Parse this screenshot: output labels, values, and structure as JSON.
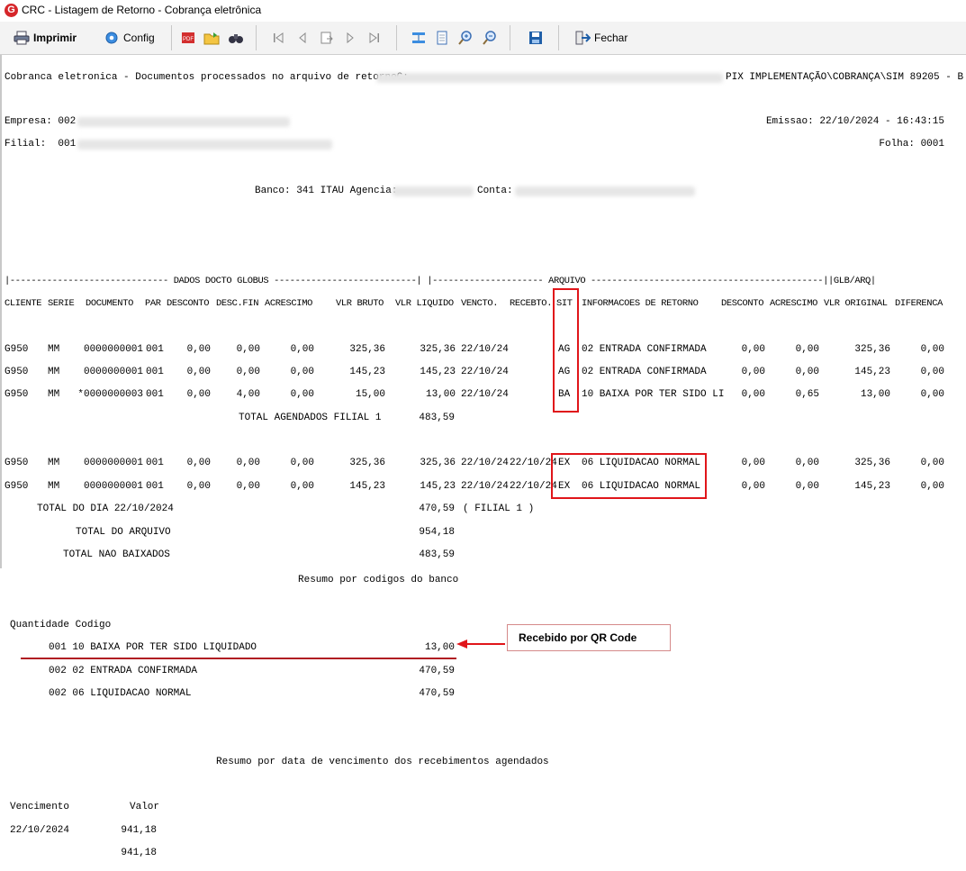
{
  "window": {
    "title": "CRC - Listagem de Retorno - Cobrança eletrônica",
    "app_icon": "G"
  },
  "toolbar": {
    "print_label": "Imprimir",
    "config_label": "Config",
    "close_label": "Fechar"
  },
  "report": {
    "title_prefix": "Cobranca eletronica - Documentos processados no arquivo de retornoC:",
    "title_suffix": "PIX IMPLEMENTAÇÃO\\COBRANÇA\\SIM 89205 - B",
    "empresa_label": "Empresa: 002",
    "filial_label": "Filial:  001",
    "emissao": "Emissao: 22/10/2024 - 16:43:15",
    "folha": "Folha: 0001",
    "banco_label": "Banco: 341 ITAU Agencia:",
    "conta_label": "Conta:",
    "section_header": "|------------------------------ DADOS DOCTO GLOBUS ---------------------------| |--------------------- ARQUIVO --------------------------------------------||GLB/ARQ|",
    "columns": [
      "CLIENTE",
      "SERIE",
      "DOCUMENTO",
      "PAR",
      "DESCONTO",
      "DESC.FIN",
      "ACRESCIMO",
      "VLR BRUTO",
      "VLR LIQUIDO",
      "VENCTO.",
      "RECEBTO.",
      "SIT",
      "INFORMACOES DE RETORNO",
      "DESCONTO",
      "ACRESCIMO",
      "VLR ORIGINAL",
      "DIFERENCA"
    ],
    "rows_agendados": [
      {
        "cliente": "G950",
        "serie": "MM",
        "documento": "0000000001",
        "par": "001",
        "desconto": "0,00",
        "desc_fin": "0,00",
        "acrescimo": "0,00",
        "vlr_bruto": "325,36",
        "vlr_liquido": "325,36",
        "vencto": "22/10/24",
        "recebto": "",
        "sit": "AG",
        "info": "02 ENTRADA CONFIRMADA",
        "desconto2": "0,00",
        "acrescimo2": "0,00",
        "vlr_original": "325,36",
        "diferenca": "0,00"
      },
      {
        "cliente": "G950",
        "serie": "MM",
        "documento": "0000000001",
        "par": "001",
        "desconto": "0,00",
        "desc_fin": "0,00",
        "acrescimo": "0,00",
        "vlr_bruto": "145,23",
        "vlr_liquido": "145,23",
        "vencto": "22/10/24",
        "recebto": "",
        "sit": "AG",
        "info": "02 ENTRADA CONFIRMADA",
        "desconto2": "0,00",
        "acrescimo2": "0,00",
        "vlr_original": "145,23",
        "diferenca": "0,00"
      },
      {
        "cliente": "G950",
        "serie": "MM",
        "documento": "*0000000003",
        "par": "001",
        "desconto": "0,00",
        "desc_fin": "4,00",
        "acrescimo": "0,00",
        "vlr_bruto": "15,00",
        "vlr_liquido": "13,00",
        "vencto": "22/10/24",
        "recebto": "",
        "sit": "BA",
        "info": "10 BAIXA POR TER SIDO LI",
        "desconto2": "0,00",
        "acrescimo2": "0,65",
        "vlr_original": "13,00",
        "diferenca": "0,00"
      }
    ],
    "total_agendados_label": "TOTAL AGENDADOS FILIAL 1",
    "total_agendados_value": "483,59",
    "rows_liquidados": [
      {
        "cliente": "G950",
        "serie": "MM",
        "documento": "0000000001",
        "par": "001",
        "desconto": "0,00",
        "desc_fin": "0,00",
        "acrescimo": "0,00",
        "vlr_bruto": "325,36",
        "vlr_liquido": "325,36",
        "vencto": "22/10/24",
        "recebto": "22/10/24",
        "sit": "EX",
        "info": "06 LIQUIDACAO NORMAL",
        "desconto2": "0,00",
        "acrescimo2": "0,00",
        "vlr_original": "325,36",
        "diferenca": "0,00"
      },
      {
        "cliente": "G950",
        "serie": "MM",
        "documento": "0000000001",
        "par": "001",
        "desconto": "0,00",
        "desc_fin": "0,00",
        "acrescimo": "0,00",
        "vlr_bruto": "145,23",
        "vlr_liquido": "145,23",
        "vencto": "22/10/24",
        "recebto": "22/10/24",
        "sit": "EX",
        "info": "06 LIQUIDACAO NORMAL",
        "desconto2": "0,00",
        "acrescimo2": "0,00",
        "vlr_original": "145,23",
        "diferenca": "0,00"
      }
    ],
    "total_dia_label": "TOTAL DO DIA 22/10/2024",
    "total_dia_value": "470,59",
    "total_dia_filial": "( FILIAL 1 )",
    "total_arquivo_label": "TOTAL DO ARQUIVO",
    "total_arquivo_value": "954,18",
    "total_nao_baixados_label": "TOTAL NAO BAIXADOS",
    "total_nao_baixados_value": "483,59",
    "resumo_codigos_title": "Resumo por codigos do banco",
    "resumo_codigos_header": "Quantidade Codigo",
    "resumo_codigos": [
      {
        "line": "001 10 BAIXA POR TER SIDO LIQUIDADO",
        "value": "13,00"
      },
      {
        "line": "002 02 ENTRADA CONFIRMADA",
        "value": "470,59"
      },
      {
        "line": "002 06 LIQUIDACAO NORMAL",
        "value": "470,59"
      }
    ],
    "resumo_vencimento_title": "Resumo por data de vencimento dos recebimentos agendados",
    "venc_header_vencimento": "Vencimento",
    "venc_header_valor": "Valor",
    "venc_rows": [
      {
        "data": "22/10/2024",
        "valor": "941,18"
      }
    ],
    "venc_total": "941,18"
  },
  "annotation": {
    "callout_text": "Recebido por QR Code"
  },
  "colors": {
    "highlight": "#e0151a",
    "underline": "#b01d22",
    "app_icon": "#d6262a"
  }
}
